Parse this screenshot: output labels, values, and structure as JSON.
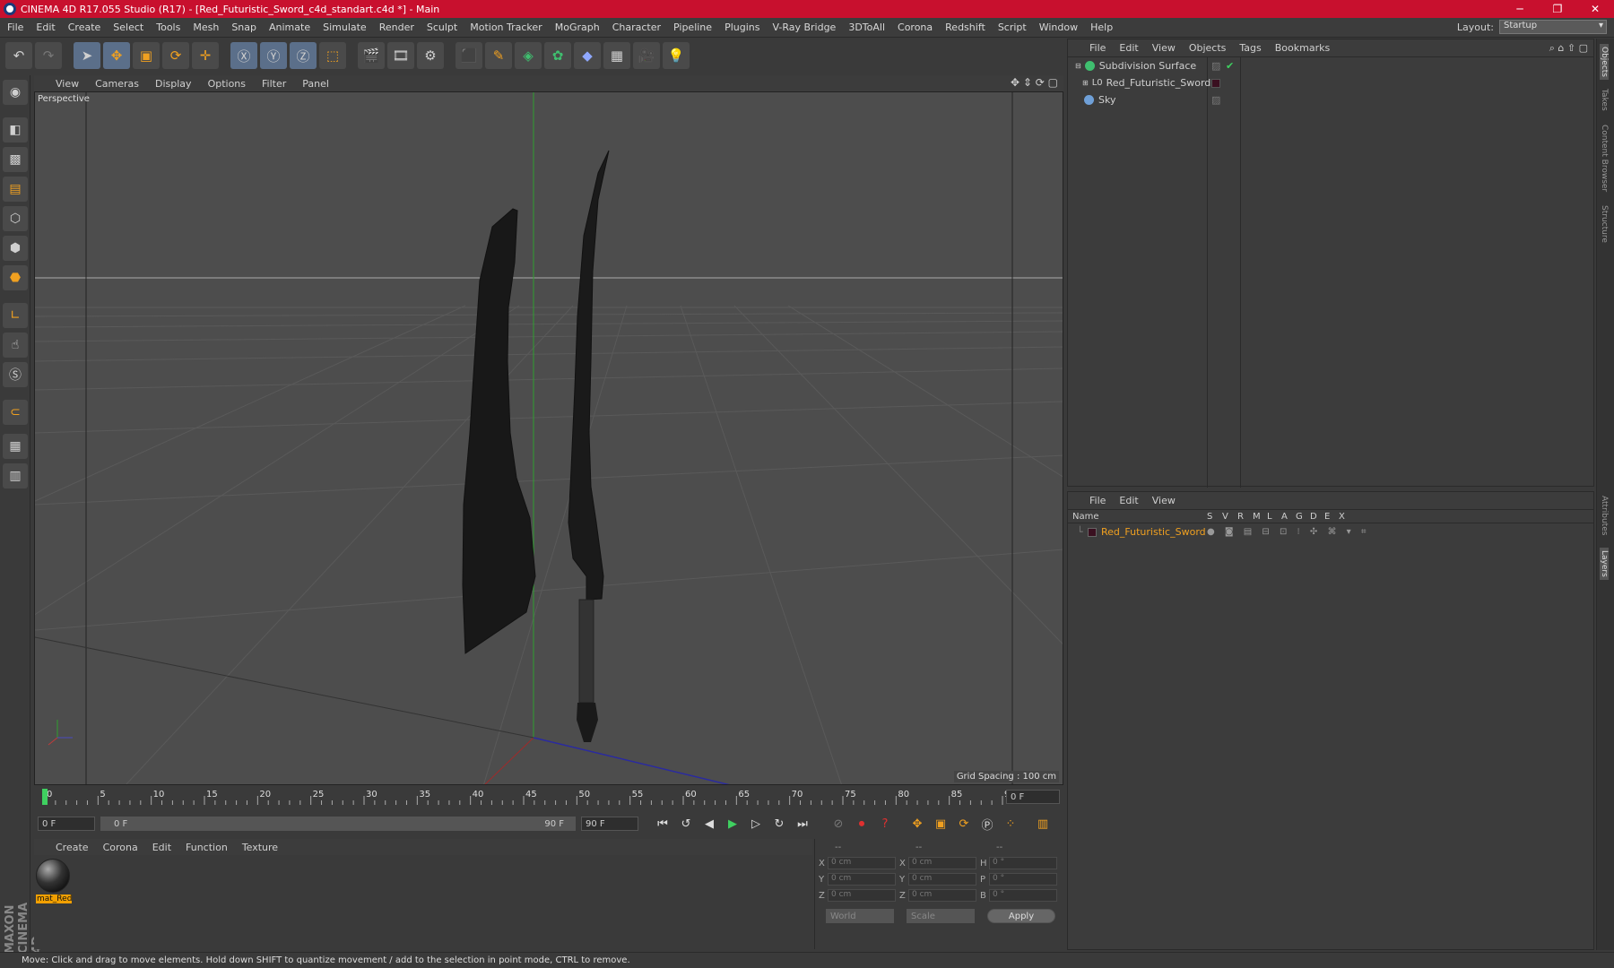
{
  "titlebar": {
    "title": "CINEMA 4D R17.055 Studio (R17) - [Red_Futuristic_Sword_c4d_standart.c4d *] - Main"
  },
  "menu": [
    "File",
    "Edit",
    "Create",
    "Select",
    "Tools",
    "Mesh",
    "Snap",
    "Animate",
    "Simulate",
    "Render",
    "Sculpt",
    "Motion Tracker",
    "MoGraph",
    "Character",
    "Pipeline",
    "Plugins",
    "V-Ray Bridge",
    "3DToAll",
    "Corona",
    "Redshift",
    "Script",
    "Window",
    "Help"
  ],
  "layout": {
    "label": "Layout:",
    "value": "Startup"
  },
  "viewport": {
    "menu": [
      "View",
      "Cameras",
      "Display",
      "Options",
      "Filter",
      "Panel"
    ],
    "label": "Perspective",
    "grid_spacing": "Grid Spacing : 100 cm"
  },
  "timeline": {
    "ticks": [
      "0",
      "5",
      "10",
      "15",
      "20",
      "25",
      "30",
      "35",
      "40",
      "45",
      "50",
      "55",
      "60",
      "65",
      "70",
      "75",
      "80",
      "85",
      "90"
    ],
    "end_field": "0 F"
  },
  "playback": {
    "start": "0 F",
    "range_start": "0 F",
    "range_end": "90 F",
    "end": "90 F"
  },
  "material_menu": [
    "Create",
    "Corona",
    "Edit",
    "Function",
    "Texture"
  ],
  "material": {
    "name": "mat_Red"
  },
  "coords": {
    "header": [
      "--",
      "--",
      "--"
    ],
    "rows": [
      {
        "a": "X",
        "av": "0 cm",
        "b": "X",
        "bv": "0 cm",
        "c": "H",
        "cv": "0 °"
      },
      {
        "a": "Y",
        "av": "0 cm",
        "b": "Y",
        "bv": "0 cm",
        "c": "P",
        "cv": "0 °"
      },
      {
        "a": "Z",
        "av": "0 cm",
        "b": "Z",
        "bv": "0 cm",
        "c": "B",
        "cv": "0 °"
      }
    ],
    "world": "World",
    "scale": "Scale",
    "apply": "Apply"
  },
  "status": "Move: Click and drag to move elements. Hold down SHIFT to quantize movement / add to the selection in point mode, CTRL to remove.",
  "objects": {
    "menu": [
      "File",
      "Edit",
      "View",
      "Objects",
      "Tags",
      "Bookmarks"
    ],
    "items": [
      {
        "name": "Subdivision Surface",
        "color": "#3fbf6f"
      },
      {
        "name": "Red_Futuristic_Sword",
        "color": "#c8c8c8"
      },
      {
        "name": "Sky",
        "color": "#6fa0d8"
      }
    ]
  },
  "layers": {
    "menu": [
      "File",
      "Edit",
      "View"
    ],
    "columns": [
      "Name",
      "S",
      "V",
      "R",
      "M",
      "L",
      "A",
      "G",
      "D",
      "E",
      "X"
    ],
    "items": [
      {
        "name": "Red_Futuristic_Sword"
      }
    ]
  },
  "right_tabs": [
    "Objects",
    "Takes",
    "Content Browser",
    "Structure",
    "Attributes",
    "Layers"
  ],
  "brand": "MAXON CINEMA 4D"
}
